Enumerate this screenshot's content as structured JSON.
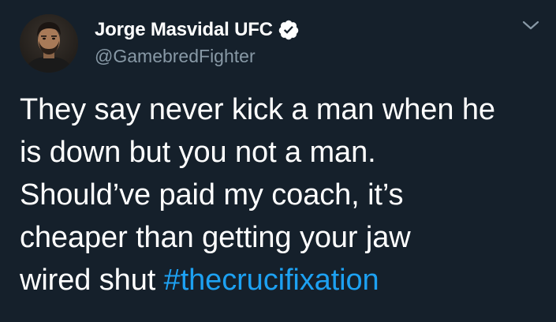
{
  "tweet": {
    "author": {
      "display_name": "Jorge Masvidal UFC",
      "handle": "@GamebredFighter",
      "verified": true,
      "avatar_icon": "user-avatar-photo",
      "verified_icon": "verified-badge-icon"
    },
    "menu_icon": "chevron-down-icon",
    "text_lines": [
      "They say never kick a man when he",
      "is down but you not a man.",
      "Should’ve paid my coach, it’s",
      "cheaper than getting your jaw",
      "wired shut "
    ],
    "hashtag": "#thecrucifixation",
    "colors": {
      "background": "#15202b",
      "text": "#ffffff",
      "secondary_text": "#8899a6",
      "link": "#1da1f2"
    }
  }
}
